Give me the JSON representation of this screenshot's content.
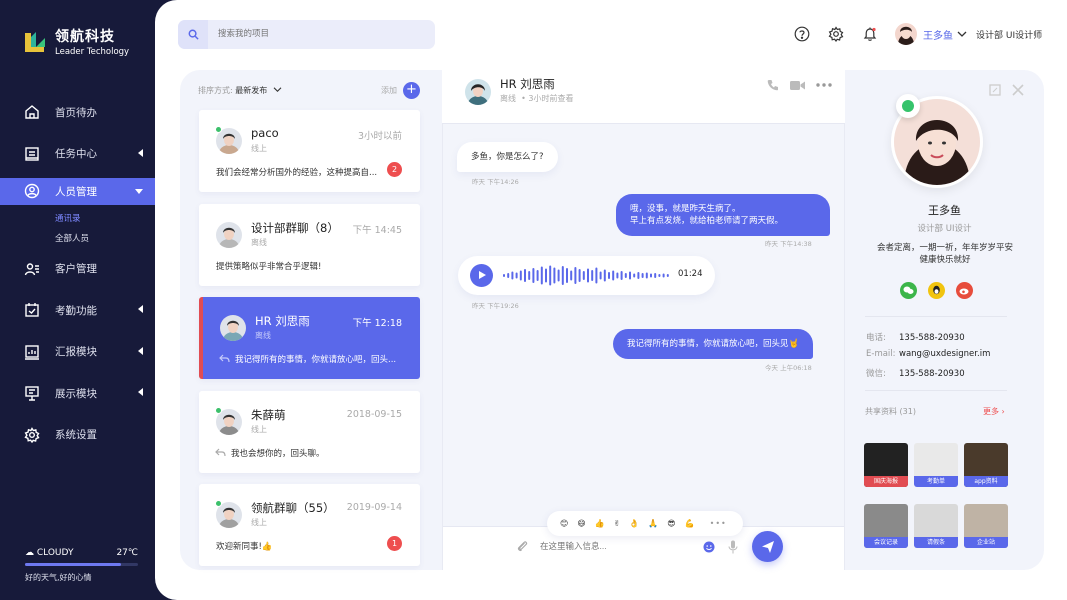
{
  "brand": {
    "name_cn": "领航科技",
    "name_en": "Leader Techology",
    "colors": {
      "accent": "#5a68ea",
      "sidebar": "#171a3a",
      "danger": "#ee4e4f",
      "online": "#3cc06b"
    }
  },
  "sidebar": {
    "items": [
      {
        "label": "首页待办",
        "icon": "home-icon"
      },
      {
        "label": "任务中心",
        "icon": "task-icon"
      },
      {
        "label": "人员管理",
        "icon": "user-circle-icon",
        "active": true
      },
      {
        "label": "客户管理",
        "icon": "customer-icon"
      },
      {
        "label": "考勤功能",
        "icon": "calendar-check-icon"
      },
      {
        "label": "汇报模块",
        "icon": "report-chart-icon"
      },
      {
        "label": "展示模块",
        "icon": "presentation-icon"
      },
      {
        "label": "系统设置",
        "icon": "gear-icon"
      }
    ],
    "sub_items": [
      "通讯录",
      "全部人员"
    ],
    "weather": {
      "condition": "CLOUDY",
      "temp": "27℃",
      "tip": "好的天气,好的心情",
      "level": 0.85
    }
  },
  "topbar": {
    "search_placeholder": "搜索我的项目",
    "icons": [
      "help-icon",
      "gear-icon",
      "bell-icon"
    ],
    "user_name": "王多鱼",
    "user_role": "设计部 UI设计师"
  },
  "list": {
    "sort_label": "排序方式:",
    "sort_value": "最新发布",
    "add_label": "添加",
    "add_symbol": "+",
    "items": [
      {
        "name": "paco",
        "status": "线上",
        "time": "3小时以前",
        "message": "我们会经常分析国外的经验，这种提高自...",
        "badge": "2",
        "online": true
      },
      {
        "name": "设计部群聊（8）",
        "status": "离线",
        "time": "下午 14:45",
        "message": "提供策略似乎非常合乎逻辑!",
        "badge": "",
        "online": false
      },
      {
        "name": "HR 刘思雨",
        "status": "离线",
        "time": "下午 12:18",
        "message": "我记得所有的事情，你就请放心吧，回头...",
        "badge": "",
        "online": false,
        "active": true,
        "reply": true
      },
      {
        "name": "朱薛萌",
        "status": "线上",
        "time": "2018-09-15",
        "message": "我也会想你的，回头聊。",
        "badge": "",
        "online": true,
        "reply": true
      },
      {
        "name": "领航群聊（55）",
        "status": "线上",
        "time": "2019-09-14",
        "message": "欢迎新同事!👍",
        "badge": "1",
        "online": true
      }
    ]
  },
  "chat": {
    "name": "HR 刘思雨",
    "status": "离线",
    "last_seen": "• 3小时前查看",
    "header_icons": [
      "phone-icon",
      "video-icon",
      "more-icon"
    ],
    "messages": [
      {
        "dir": "in",
        "text": "多鱼，你是怎么了?",
        "time": "昨天 下午14:26"
      },
      {
        "dir": "out",
        "text_1": "哦，没事，就是昨天生病了。",
        "text_2": "早上有点发烧，就给柏老师请了两天假。",
        "time": "昨天 下午14:38"
      },
      {
        "dir": "in",
        "type": "voice",
        "duration": "01:24",
        "time": "昨天 下午19:26"
      },
      {
        "dir": "out",
        "text": "我记得所有的事情，你就请放心吧，回头见🤘",
        "time": "今天 上午06:18"
      }
    ],
    "emojis": [
      "😊",
      "😄",
      "👍",
      "✌",
      "👌",
      "🙏",
      "😎",
      "💪"
    ],
    "emoji_more": "•••",
    "input_placeholder": "在这里输入信息..."
  },
  "profile": {
    "name": "王多鱼",
    "dept": "设计部 UI设计",
    "bio_1": "会者定离，一期一祈，年年岁岁平安",
    "bio_2": "健康快乐就好",
    "social": [
      {
        "icon": "wechat-icon",
        "color": "#3cb54a"
      },
      {
        "icon": "qq-icon",
        "color": "#f1c40f"
      },
      {
        "icon": "weibo-icon",
        "color": "#e74c3c"
      }
    ],
    "phone_label": "电话:",
    "phone": "135-588-20930",
    "email_label": "E-mail:",
    "email": "wang@uxdesigner.im",
    "wechat_label": "微信:",
    "wechat": "135-588-20930",
    "shared_label": "共享资料 (31)",
    "more_label": "更多 ›",
    "files": [
      {
        "label": "国庆海报",
        "color": "#e14c52"
      },
      {
        "label": "考勤单",
        "color": "#5a68ea"
      },
      {
        "label": "app资料",
        "color": "#5a68ea"
      },
      {
        "label": "会议记录",
        "color": "#5a68ea"
      },
      {
        "label": "请假条",
        "color": "#5a68ea"
      },
      {
        "label": "企业站",
        "color": "#5a68ea"
      }
    ]
  }
}
